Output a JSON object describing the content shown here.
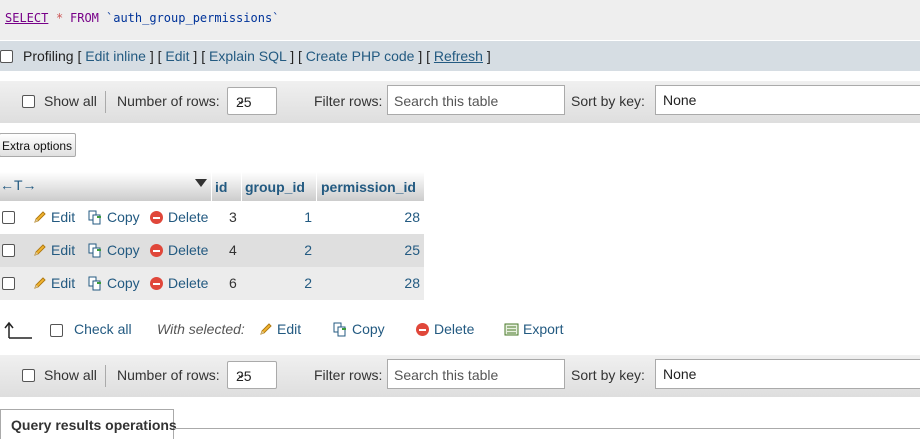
{
  "sql": {
    "select": "SELECT",
    "star": "*",
    "from": "FROM",
    "table": "`auth_group_permissions`"
  },
  "profiling": {
    "label": "Profiling",
    "edit_inline": "Edit inline",
    "edit": "Edit",
    "explain_sql": "Explain SQL",
    "create_php": "Create PHP code",
    "refresh": "Refresh"
  },
  "nav": {
    "show_all": "Show all",
    "number_of_rows_label": "Number of rows:",
    "number_of_rows_value": "25",
    "filter_rows_label": "Filter rows:",
    "search_placeholder": "Search this table",
    "sort_by_key_label": "Sort by key:",
    "sort_by_key_value": "None"
  },
  "extra_options": "Extra options",
  "table": {
    "arrows": "←T→",
    "columns": [
      "id",
      "group_id",
      "permission_id"
    ],
    "actions": {
      "edit": "Edit",
      "copy": "Copy",
      "delete": "Delete"
    },
    "rows": [
      {
        "id": "3",
        "group_id": "1",
        "permission_id": "28"
      },
      {
        "id": "4",
        "group_id": "2",
        "permission_id": "25"
      },
      {
        "id": "6",
        "group_id": "2",
        "permission_id": "28"
      }
    ]
  },
  "bulk": {
    "check_all": "Check all",
    "with_selected": "With selected:",
    "edit": "Edit",
    "copy": "Copy",
    "delete": "Delete",
    "export": "Export"
  },
  "query_results_operations": "Query results operations"
}
